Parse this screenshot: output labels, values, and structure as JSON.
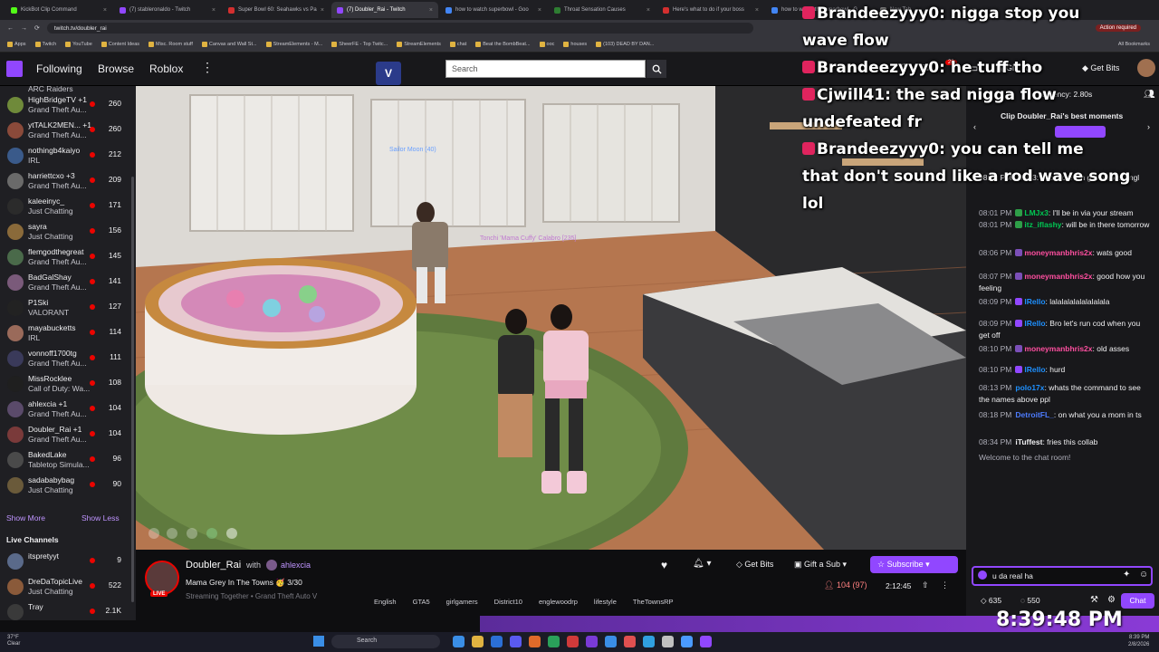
{
  "browser": {
    "tabs": [
      {
        "label": "KickBot Clip Command",
        "color": "#53fc18"
      },
      {
        "label": "(7) stableronaldo - Twitch",
        "color": "#9147ff"
      },
      {
        "label": "Super Bowl 60: Seahawks vs Pa",
        "color": "#d32f2f"
      },
      {
        "label": "(7) Doubler_Rai - Twitch",
        "color": "#9147ff"
      },
      {
        "label": "how to watch superbowl - Goo",
        "color": "#4285f4"
      },
      {
        "label": "Throat Sensation Causes",
        "color": "#2e7d32"
      },
      {
        "label": "Here's what to do if your boss",
        "color": "#d32f2f"
      },
      {
        "label": "how to watch the superbowl - G",
        "color": "#4285f4"
      },
      {
        "label": "New Tab",
        "color": "#888888"
      }
    ],
    "url": "twitch.tv/doubler_rai",
    "action_required": "Action required",
    "bookmarks": [
      "Apps",
      "Twitch",
      "YouTube",
      "Content Ideas",
      "Misc. Room stuff",
      "Canvas and Wall St...",
      "StreamElements - M...",
      "SheerFE - Top Twitc...",
      "StreamElements",
      "chat",
      "Beat the BombBeat...",
      "ooc",
      "houses",
      "(103) DEAD BY DAN..."
    ],
    "all_bookmarks": "All Bookmarks"
  },
  "nav": {
    "following": "Following",
    "browse": "Browse",
    "roblox": "Roblox",
    "search_placeholder": "Search",
    "gift_turbo": "Gift Turbo",
    "get_bits": "Get Bits",
    "notif_count": "28",
    "msg_count": "7"
  },
  "sidebar": {
    "top_fragment": "ARC Raiders",
    "channels": [
      {
        "name": "HighBridgeTV +1",
        "game": "Grand Theft Au...",
        "viewers": "260",
        "color": "#6f8a3a"
      },
      {
        "name": "ytTALK2MEN... +1",
        "game": "Grand Theft Au...",
        "viewers": "260",
        "color": "#8a4a3a"
      },
      {
        "name": "nothingb4kaiyo",
        "game": "IRL",
        "viewers": "212",
        "color": "#3a5a8a"
      },
      {
        "name": "harriettcxo +3",
        "game": "Grand Theft Au...",
        "viewers": "209",
        "color": "#6a6a6a"
      },
      {
        "name": "kaleeinyc_",
        "game": "Just Chatting",
        "viewers": "171",
        "color": "#2b2b2b"
      },
      {
        "name": "sayra",
        "game": "Just Chatting",
        "viewers": "156",
        "color": "#8a6a3a"
      },
      {
        "name": "flemgodthegreat",
        "game": "Grand Theft Au...",
        "viewers": "145",
        "color": "#4a6a4a"
      },
      {
        "name": "BadGalShay",
        "game": "Grand Theft Au...",
        "viewers": "141",
        "color": "#7a5a7a"
      },
      {
        "name": "P1Ski",
        "game": "VALORANT",
        "viewers": "127",
        "color": "#222222"
      },
      {
        "name": "mayabucketts",
        "game": "IRL",
        "viewers": "114",
        "color": "#9a6a5a"
      },
      {
        "name": "vonnoff1700tg",
        "game": "Grand Theft Au...",
        "viewers": "111",
        "color": "#3a3a5a"
      },
      {
        "name": "MissRocklee",
        "game": "Call of Duty: Wa...",
        "viewers": "108",
        "color": "#1f1f1f"
      },
      {
        "name": "ahlexcia +1",
        "game": "Grand Theft Au...",
        "viewers": "104",
        "color": "#5a4a6a"
      },
      {
        "name": "Doubler_Rai +1",
        "game": "Grand Theft Au...",
        "viewers": "104",
        "color": "#7a3a3a"
      },
      {
        "name": "BakedLake",
        "game": "Tabletop Simula...",
        "viewers": "96",
        "color": "#4a4a4a"
      },
      {
        "name": "sadababybag",
        "game": "Just Chatting",
        "viewers": "90",
        "color": "#6a5a3a"
      }
    ],
    "show_more": "Show More",
    "show_less": "Show Less",
    "live_channels_heading": "Live Channels",
    "live_channels": [
      {
        "name": "itspretyyt",
        "game": "",
        "viewers": "9",
        "color": "#5a6a8a"
      },
      {
        "name": "DreDaTopicLive",
        "game": "Just Chatting",
        "viewers": "522",
        "color": "#8a5a3a"
      },
      {
        "name": "Tray",
        "game": "",
        "viewers": "2.1K",
        "color": "#3a3a3a"
      }
    ]
  },
  "stream": {
    "streamer": "Doubler_Rai",
    "with": "with",
    "cohost": "ahlexcia",
    "title": "Mama Grey In The Towns 🥳 3/30",
    "subtitle": "Streaming Together • Grand Theft Auto V",
    "live_badge": "LIVE",
    "tags": [
      "English",
      "GTA5",
      "girlgamers",
      "District10",
      "englewoodrp",
      "lifestyle",
      "TheTownsRP"
    ],
    "get_bits": "Get Bits",
    "gift_sub": "Gift a Sub",
    "subscribe": "Subscribe",
    "viewers": "104 (97)",
    "uptime": "2:12:45",
    "game_name_1": "Sailor Moon (40)",
    "game_name_2": "Tonchi 'Mama Cuffy' Calabro [235]"
  },
  "chat": {
    "latency": "Latency: 2.80s",
    "clip_banner": "Clip Doubler_Rai's best moments",
    "messages": [
      {
        "time": "",
        "user": "",
        "color": "#efeff1",
        "badge": "",
        "text": "08:01 PM  LMJx3: I cba to even get back up ngl"
      },
      {
        "time": "08:01 PM",
        "user": "LMJx3",
        "color": "#00c853",
        "badge": "#2e9e48",
        "text": ": I'll be in via your stream"
      },
      {
        "time": "08:01 PM",
        "user": "itz_iflashy",
        "color": "#00c853",
        "badge": "#2e9e48",
        "text": ": will be in there tomorrow"
      },
      {
        "time": "08:06 PM",
        "user": "moneymanbhris2x",
        "color": "#ff4fa0",
        "badge": "#7b4fb8",
        "text": ": wats good"
      },
      {
        "time": "08:07 PM",
        "user": "moneymanbhris2x",
        "color": "#ff4fa0",
        "badge": "#7b4fb8",
        "text": ": good how you feeling"
      },
      {
        "time": "08:09 PM",
        "user": "lRello",
        "color": "#1e90ff",
        "badge": "#9147ff",
        "text": ": lalalalalalalalalala"
      },
      {
        "time": "08:09 PM",
        "user": "lRello",
        "color": "#1e90ff",
        "badge": "#9147ff",
        "text": ": Bro let's run cod when you get off"
      },
      {
        "time": "08:10 PM",
        "user": "moneymanbhris2x",
        "color": "#ff4fa0",
        "badge": "#7b4fb8",
        "text": ": old asses"
      },
      {
        "time": "08:10 PM",
        "user": "lRello",
        "color": "#1e90ff",
        "badge": "#9147ff",
        "text": ": hurd"
      },
      {
        "time": "08:13 PM",
        "user": "polo17x",
        "color": "#1e90ff",
        "badge": "",
        "text": ": whats the command to see the names above ppl"
      },
      {
        "time": "08:18 PM",
        "user": "DetroitFL_",
        "color": "#4d7cff",
        "badge": "",
        "text": ": on what you a mom in ts"
      },
      {
        "time": "08:34 PM",
        "user": "iTuffest",
        "color": "#efeff1",
        "badge": "",
        "text": ": fries this collab"
      }
    ],
    "welcome": "Welcome to the chat room!",
    "input_value": "u da real ha",
    "points": "635",
    "points2": "550",
    "chat_button": "Chat"
  },
  "overlay": {
    "lines": [
      {
        "user": "Brandeezyyy0",
        "text": ": nigga stop you"
      },
      {
        "user": "",
        "text": "wave flow"
      },
      {
        "user": "Brandeezyyy0",
        "text": ": he tuff tho"
      },
      {
        "user": "Cjwill41",
        "text": ": the sad nigga flow"
      },
      {
        "user": "",
        "text": "undefeated fr"
      },
      {
        "user": "Brandeezyyy0",
        "text": ": you can tell me"
      },
      {
        "user": "",
        "text": "that don't sound like a rod wave song"
      },
      {
        "user": "",
        "text": "lol"
      }
    ]
  },
  "taskbar": {
    "search": "Search",
    "time": "8:39 PM",
    "date": "2/8/2026",
    "weather": "37°F",
    "weather_label": "Clear",
    "big_clock": "8:39:48 PM"
  }
}
